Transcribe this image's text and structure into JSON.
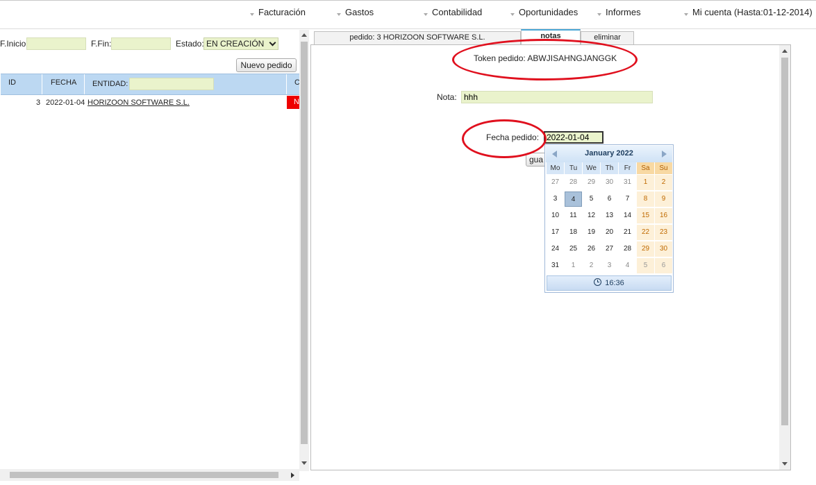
{
  "nav": {
    "facturacion": "Facturación",
    "gastos": "Gastos",
    "contabilidad": "Contabilidad",
    "oportunidades": "Oportunidades",
    "informes": "Informes",
    "mi_cuenta": "Mi cuenta (Hasta:01-12-2014)"
  },
  "filters": {
    "f_inicio_label": "F.Inicio:",
    "f_fin_label": "F.Fin:",
    "estado_label": "Estado:",
    "estado_value": "EN CREACIÓN",
    "nuevo_pedido": "Nuevo pedido"
  },
  "grid": {
    "col_id": "ID",
    "col_fecha": "FECHA",
    "col_entidad": "ENTIDAD:",
    "col_extra": "C",
    "rows": [
      {
        "id": "3",
        "fecha": "2022-01-04",
        "entidad": "HORIZOON SOFTWARE S.L.",
        "extra": "N"
      }
    ]
  },
  "tabs": {
    "pedido": "pedido: 3 HORIZOON SOFTWARE S.L.",
    "notas": "notas",
    "eliminar": "eliminar"
  },
  "form": {
    "token": "Token pedido: ABWJISAHNGJANGGK",
    "nota_label": "Nota:",
    "nota_value": "hhh",
    "fecha_label": "Fecha pedido:",
    "fecha_value": "2022-01-04",
    "guardar": "gua"
  },
  "calendar": {
    "title": "January 2022",
    "days_of_week": [
      "Mo",
      "Tu",
      "We",
      "Th",
      "Fr",
      "Sa",
      "Su"
    ],
    "weeks": [
      [
        "27",
        "28",
        "29",
        "30",
        "31",
        "1",
        "2"
      ],
      [
        "3",
        "4",
        "5",
        "6",
        "7",
        "8",
        "9"
      ],
      [
        "10",
        "11",
        "12",
        "13",
        "14",
        "15",
        "16"
      ],
      [
        "17",
        "18",
        "19",
        "20",
        "21",
        "22",
        "23"
      ],
      [
        "24",
        "25",
        "26",
        "27",
        "28",
        "29",
        "30"
      ],
      [
        "31",
        "1",
        "2",
        "3",
        "4",
        "5",
        "6"
      ]
    ],
    "selected_day": "4",
    "time": "16:36"
  },
  "colors": {
    "highlight_ellipse": "#e0101e",
    "grid_header": "#bcd8f2",
    "input_bg": "#eaf3cc",
    "tab_accent": "#4aa6d6"
  }
}
